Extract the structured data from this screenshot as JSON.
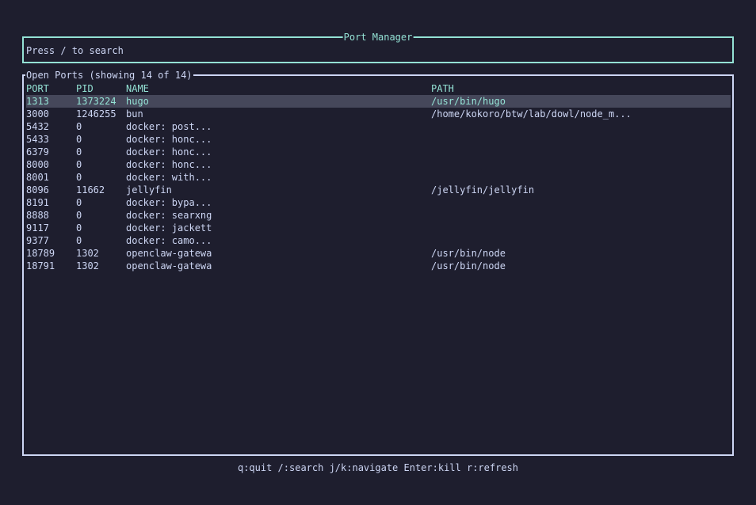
{
  "app": {
    "title": "Port Manager"
  },
  "search": {
    "placeholder": "Press / to search"
  },
  "ports_panel": {
    "title": "Open Ports (showing 14 of 14)",
    "columns": [
      "PORT",
      "PID",
      "NAME",
      "PATH"
    ],
    "selected_index": 0,
    "rows": [
      {
        "port": "1313",
        "pid": "1373224",
        "name": "hugo",
        "path": "/usr/bin/hugo"
      },
      {
        "port": "3000",
        "pid": "1246255",
        "name": "bun",
        "path": "/home/kokoro/btw/lab/dowl/node_m..."
      },
      {
        "port": "5432",
        "pid": "0",
        "name": "docker: post...",
        "path": ""
      },
      {
        "port": "5433",
        "pid": "0",
        "name": "docker: honc...",
        "path": ""
      },
      {
        "port": "6379",
        "pid": "0",
        "name": "docker: honc...",
        "path": ""
      },
      {
        "port": "8000",
        "pid": "0",
        "name": "docker: honc...",
        "path": ""
      },
      {
        "port": "8001",
        "pid": "0",
        "name": "docker: with...",
        "path": ""
      },
      {
        "port": "8096",
        "pid": "11662",
        "name": "jellyfin",
        "path": "/jellyfin/jellyfin"
      },
      {
        "port": "8191",
        "pid": "0",
        "name": "docker: bypa...",
        "path": ""
      },
      {
        "port": "8888",
        "pid": "0",
        "name": "docker: searxng",
        "path": ""
      },
      {
        "port": "9117",
        "pid": "0",
        "name": "docker: jackett",
        "path": ""
      },
      {
        "port": "9377",
        "pid": "0",
        "name": "docker: camo...",
        "path": ""
      },
      {
        "port": "18789",
        "pid": "1302",
        "name": "openclaw-gatewa",
        "path": "/usr/bin/node"
      },
      {
        "port": "18791",
        "pid": "1302",
        "name": "openclaw-gatewa",
        "path": "/usr/bin/node"
      }
    ]
  },
  "footer": {
    "help": "q:quit /:search j/k:navigate Enter:kill r:refresh"
  },
  "colors": {
    "background": "#1e1e2e",
    "accent": "#94e2d5",
    "text": "#cdd6f4",
    "selection": "#45475a"
  }
}
